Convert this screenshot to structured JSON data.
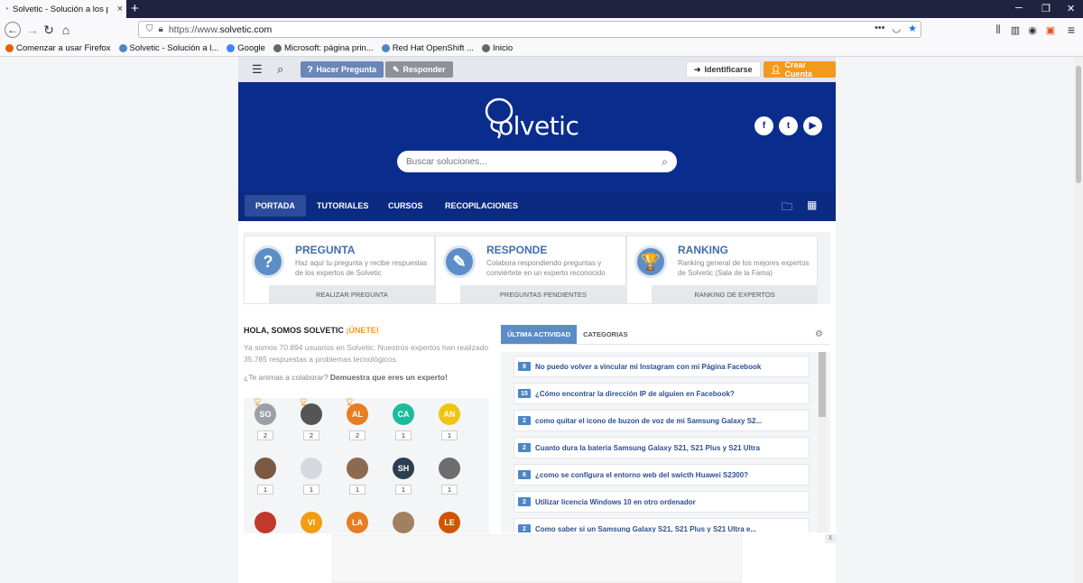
{
  "browser": {
    "tab_title": "Solvetic - Solución a los proble",
    "url_prefix": "https://www.",
    "url_domain": "solvetic.com",
    "bookmarks": [
      {
        "label": "Comenzar a usar Firefox",
        "color": "#e66000"
      },
      {
        "label": "Solvetic - Solución a l...",
        "color": "#4a86c8"
      },
      {
        "label": "Google",
        "color": "#4285f4"
      },
      {
        "label": "Microsoft: página prin...",
        "color": "#666666"
      },
      {
        "label": "Red Hat OpenShift ...",
        "color": "#4a86c8"
      },
      {
        "label": "Inicio",
        "color": "#666666"
      }
    ]
  },
  "topbar": {
    "ask_label": "Hacer Pregunta",
    "answer_label": "Responder",
    "login_label": "Identificarse",
    "signup_label": "Crear Cuenta"
  },
  "hero": {
    "logo_text": "olvetic",
    "search_placeholder": "Buscar soluciones..."
  },
  "nav": {
    "items": [
      "PORTADA",
      "TUTORIALES",
      "CURSOS",
      "RECOPILACIONES"
    ]
  },
  "cards": [
    {
      "title": "PREGUNTA",
      "desc": "Haz aquí tu pregunta y recibe respuestas de los expertos de Solvetic",
      "button": "REALIZAR PREGUNTA",
      "icon": "?"
    },
    {
      "title": "RESPONDE",
      "desc": "Colabora respondiendo preguntas y conviértete en un experto reconocido",
      "button": "PREGUNTAS PENDIENTES",
      "icon": "✎"
    },
    {
      "title": "RANKING",
      "desc": "Ranking general de los mejores expertos de Solvetic (Sala de la Fama)",
      "button": "RANKING DE EXPERTOS",
      "icon": "🏆"
    }
  ],
  "intro": {
    "heading": "HOLA, SOMOS SOLVETIC",
    "join": "¡ÚNETE!",
    "text": "Ya somos 70.894 usuarios en Solvetic. Nuestros expertos han realizado 35.785 respuestas a problemas tecnológicos.",
    "cta_prefix": "¿Te animas a colaborar?",
    "cta_bold": "Demuestra que eres un experto!"
  },
  "users": [
    {
      "initials": "SO",
      "color": "#9aa0a6",
      "count": "2",
      "trophy": true
    },
    {
      "initials": "",
      "color": "#555555",
      "count": "2",
      "trophy": true
    },
    {
      "initials": "AL",
      "color": "#e67e22",
      "count": "2",
      "trophy": true
    },
    {
      "initials": "CA",
      "color": "#1abc9c",
      "count": "1",
      "trophy": false
    },
    {
      "initials": "AN",
      "color": "#f1c40f",
      "count": "1",
      "trophy": false
    },
    {
      "initials": "",
      "color": "#7a5a40",
      "count": "1",
      "trophy": false
    },
    {
      "initials": "",
      "color": "#d5d8dc",
      "count": "1",
      "trophy": false
    },
    {
      "initials": "",
      "color": "#8c6a50",
      "count": "1",
      "trophy": false
    },
    {
      "initials": "SH",
      "color": "#2c3e50",
      "count": "1",
      "trophy": false
    },
    {
      "initials": "",
      "color": "#6d6d6d",
      "count": "1",
      "trophy": false
    },
    {
      "initials": "",
      "color": "#c0392b",
      "count": "",
      "trophy": false
    },
    {
      "initials": "VI",
      "color": "#f39c12",
      "count": "",
      "trophy": false
    },
    {
      "initials": "LA",
      "color": "#e67e22",
      "count": "",
      "trophy": false
    },
    {
      "initials": "",
      "color": "#a08060",
      "count": "",
      "trophy": false
    },
    {
      "initials": "LE",
      "color": "#d35400",
      "count": "",
      "trophy": false
    }
  ],
  "activity": {
    "tab_active": "ÚLTIMA ACTIVIDAD",
    "tab_other": "CATEGORIAS",
    "items": [
      {
        "count": "9",
        "text": "No puedo volver a vincular mi Instagram con mi Página Facebook"
      },
      {
        "count": "15",
        "text": "¿Cómo encontrar la dirección IP de alguien en Facebook?"
      },
      {
        "count": "2",
        "text": "como quitar el icono de buzon de voz de mi Samsung Galaxy S2..."
      },
      {
        "count": "2",
        "text": "Cuanto dura la bateria Samsung Galaxy S21, S21 Plus y S21 Ultra"
      },
      {
        "count": "6",
        "text": "¿como se configura el entorno web del swicth Huawei S2300?"
      },
      {
        "count": "2",
        "text": "Utilizar licencia Windows 10 en otro ordenador"
      },
      {
        "count": "2",
        "text": "Como saber si un Samsung Galaxy S21, S21 Plus y S21 Ultra e..."
      }
    ]
  },
  "ad": {
    "close_label": "X"
  }
}
